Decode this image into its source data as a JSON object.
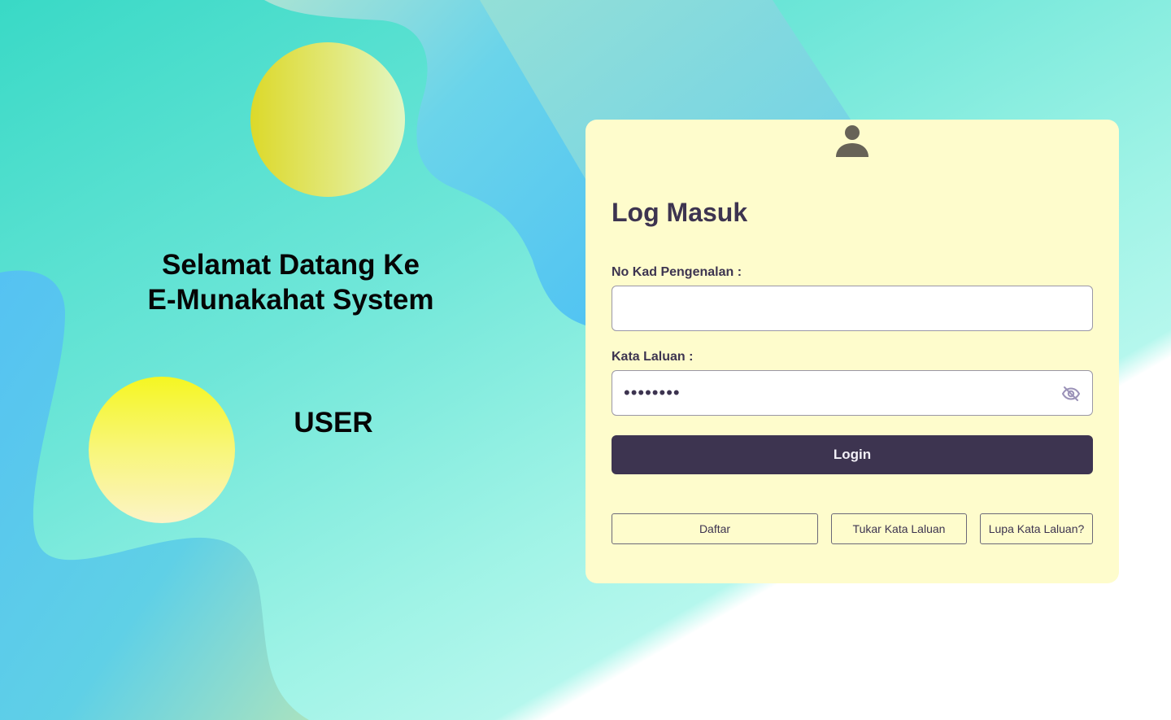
{
  "welcome": {
    "line1": "Selamat Datang Ke",
    "line2": "E-Munakahat System",
    "role": "USER"
  },
  "login": {
    "icon": "user-icon",
    "title": "Log Masuk",
    "ic_label": "No Kad Pengenalan :",
    "ic_value": "",
    "password_label": "Kata Laluan :",
    "password_mask": "••••••••",
    "password_toggle_icon": "eye-off-icon",
    "submit_label": "Login",
    "register_label": "Daftar",
    "change_password_label": "Tukar Kata Laluan",
    "forgot_password_label": "Lupa Kata Laluan?"
  },
  "colors": {
    "accent": "#3d3450",
    "card_bg": "#fefccc",
    "teal": "#39d9c6",
    "blue": "#5bc3f0",
    "yellow": "#f5f622"
  }
}
